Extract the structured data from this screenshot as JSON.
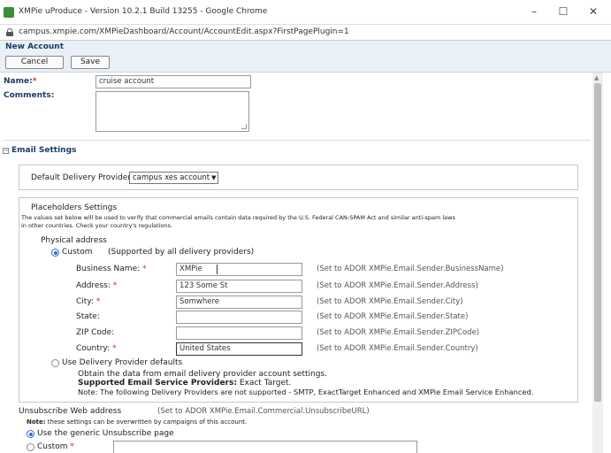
{
  "window": {
    "title": "XMPie uProduce - Version 10.2.1 Build 13255 - Google Chrome",
    "minimize": "–",
    "maximize": "☐",
    "close": "✕"
  },
  "browser": {
    "url": "campus.xmpie.com/XMPieDashboard/Account/AccountEdit.aspx?FirstPagePlugin=1"
  },
  "page": {
    "title": "New Account",
    "cancel_label": "Cancel",
    "save_label": "Save"
  },
  "account": {
    "name_label": "Name:",
    "name_value": "cruise account",
    "comments_label": "Comments:",
    "comments_value": ""
  },
  "email_settings": {
    "section_title": "Email Settings",
    "collapse_symbol": "−",
    "delivery_provider_label": "Default Delivery Provider",
    "delivery_provider_value": "campus xes account",
    "placeholders_title": "Placeholders Settings",
    "placeholders_desc_1": "The values set below will be used to verify that commercial emails contain data required by the U.S. Federal CAN-SPAM Act and similar anti-spam laws",
    "placeholders_desc_2": "in other countries. Check your country's regulations.",
    "physical_address_label": "Physical address",
    "custom_label": "Custom",
    "custom_note": "(Supported by all delivery providers)",
    "fields": [
      {
        "label": "Business Name:",
        "required": true,
        "value": "XMPie",
        "hint": "(Set to ADOR XMPie.Email.Sender.BusinessName)"
      },
      {
        "label": "Address:",
        "required": true,
        "value": "123 Some St",
        "hint": "(Set to ADOR XMPie.Email.Sender.Address)"
      },
      {
        "label": "City:",
        "required": true,
        "value": "Somwhere",
        "hint": "(Set to ADOR XMPie.Email.Sender.City)"
      },
      {
        "label": "State:",
        "required": false,
        "value": "",
        "hint": "(Set to ADOR XMPie.Email.Sender.State)"
      },
      {
        "label": "ZIP Code:",
        "required": false,
        "value": "",
        "hint": "(Set to ADOR XMPie.Email.Sender.ZIPCode)"
      },
      {
        "label": "Country:",
        "required": true,
        "value": "United States",
        "hint": "(Set to ADOR XMPie.Email.Sender.Country)"
      }
    ],
    "use_provider_defaults_label": "Use Delivery Provider defaults",
    "provider_defaults_line1": "Obtain the data from email delivery provider account settings.",
    "supported_providers_label": "Supported Email Service Providers:",
    "supported_providers_value": "Exact Target.",
    "provider_defaults_line3": "Note: The following Delivery Providers are not supported - SMTP, ExactTarget Enhanced and XMPie Email Service Enhanced.",
    "unsubscribe_label": "Unsubscribe Web address",
    "unsubscribe_hint": "(Set to ADOR XMPie.Email.Commercial.UnsubscribeURL)",
    "note_label": "Note:",
    "note_text": "these settings can be overwritten by campaigns of this account.",
    "generic_unsubscribe_label": "Use the generic Unsubscribe page",
    "custom_unsubscribe_label": "Custom",
    "custom_unsubscribe_value": ""
  },
  "required_marker": "*",
  "colors": {
    "header_bg": "#e9f0f7",
    "label_blue": "#1c3b66",
    "required_red": "#d22222",
    "radio_blue": "#2a6fcc"
  }
}
